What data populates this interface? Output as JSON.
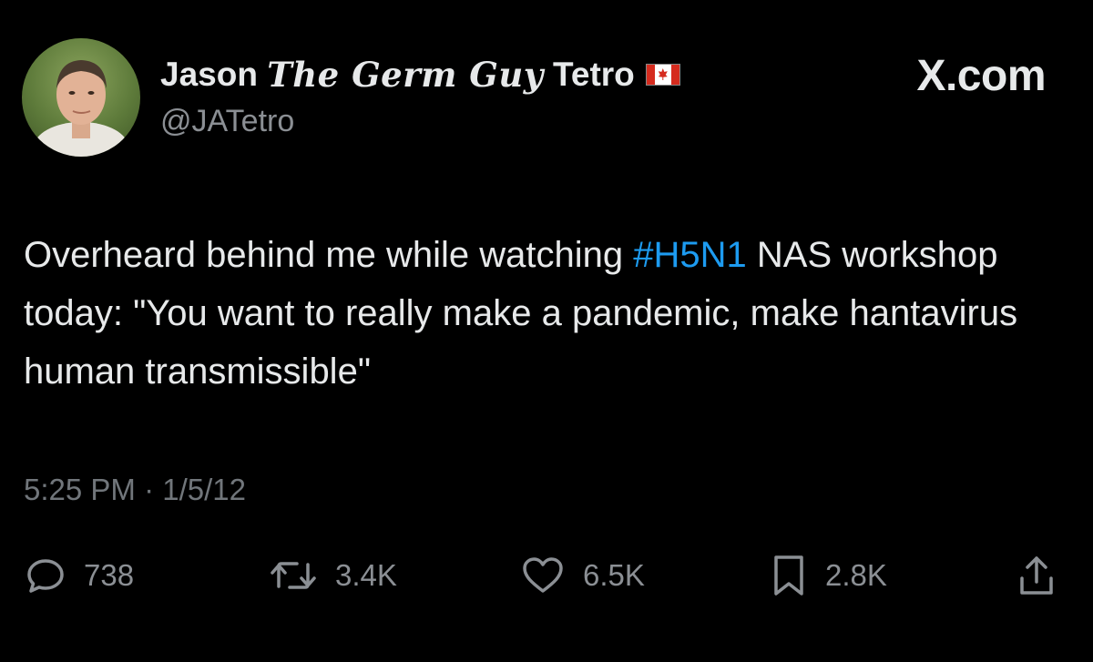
{
  "author": {
    "name_first": "Jason",
    "name_middle": "The Germ Guy",
    "name_last": "Tetro",
    "flag_icon": "canada-flag-icon",
    "handle": "@JATetro"
  },
  "brand": {
    "label": "X.com"
  },
  "tweet": {
    "text_before": "Overheard behind me while watching ",
    "hashtag": "#H5N1",
    "text_after": " NAS workshop today: \"You want to really make a pandemic, make hantavirus human transmissible\"",
    "time": "5:25 PM",
    "separator": "·",
    "date": "1/5/12"
  },
  "actions": {
    "replies": "738",
    "reposts": "3.4K",
    "likes": "6.5K",
    "bookmarks": "2.8K"
  },
  "colors": {
    "background": "#000000",
    "text": "#e7e9ea",
    "muted": "#71767b",
    "accent": "#1d9bf0"
  }
}
